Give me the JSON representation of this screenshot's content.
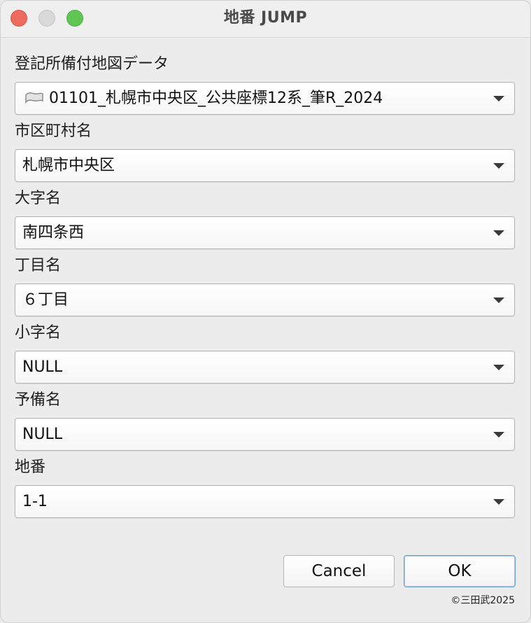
{
  "window": {
    "title": "地番 JUMP"
  },
  "fields": {
    "registry_map": {
      "label": "登記所備付地図データ",
      "value": "01101_札幌市中央区_公共座標12系_筆R_2024",
      "icon": "polygon-layer-icon"
    },
    "municipality": {
      "label": "市区町村名",
      "value": "札幌市中央区"
    },
    "oaza": {
      "label": "大字名",
      "value": "南四条西"
    },
    "chome": {
      "label": "丁目名",
      "value": "６丁目"
    },
    "koaza": {
      "label": "小字名",
      "value": "NULL"
    },
    "yobi": {
      "label": "予備名",
      "value": "NULL"
    },
    "chiban": {
      "label": "地番",
      "value": "1-1"
    }
  },
  "buttons": {
    "cancel": "Cancel",
    "ok": "OK"
  },
  "footer": {
    "copyright": "©三田武2025"
  },
  "colors": {
    "close": "#ed6a5e",
    "minimize": "#d9d9d9",
    "zoom": "#61c554",
    "default_button_border": "#6aa1dd"
  }
}
